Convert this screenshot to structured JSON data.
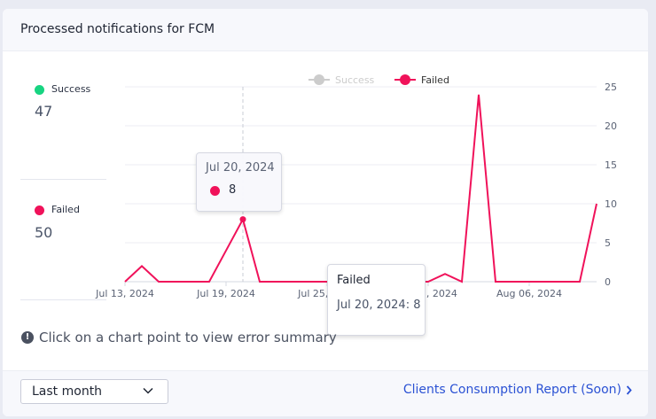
{
  "card": {
    "title": "Processed notifications for FCM"
  },
  "stats": [
    {
      "label": "Success",
      "value": "47",
      "color": "#17d481"
    },
    {
      "label": "Failed",
      "value": "50",
      "color": "#f0125a"
    }
  ],
  "chart_data": {
    "type": "line",
    "x_ticks": [
      "Jul 13, 2024",
      "Jul 19, 2024",
      "Jul 25, 2024",
      "Jul 31, 2024",
      "Aug 06, 2024"
    ],
    "y_ticks": [
      "25",
      "20",
      "15",
      "10",
      "5",
      "0"
    ],
    "ylim": [
      0,
      25
    ],
    "legend_position": "top-center",
    "grid": "horizontal",
    "x": [
      "Jul 13, 2024",
      "Jul 14, 2024",
      "Jul 15, 2024",
      "Jul 16, 2024",
      "Jul 17, 2024",
      "Jul 18, 2024",
      "Jul 19, 2024",
      "Jul 20, 2024",
      "Jul 21, 2024",
      "Jul 22, 2024",
      "Jul 23, 2024",
      "Jul 24, 2024",
      "Jul 25, 2024",
      "Jul 26, 2024",
      "Jul 27, 2024",
      "Jul 28, 2024",
      "Jul 29, 2024",
      "Jul 30, 2024",
      "Jul 31, 2024",
      "Aug 01, 2024",
      "Aug 02, 2024",
      "Aug 03, 2024",
      "Aug 04, 2024",
      "Aug 05, 2024",
      "Aug 06, 2024",
      "Aug 07, 2024",
      "Aug 08, 2024",
      "Aug 09, 2024",
      "Aug 10, 2024"
    ],
    "series": [
      {
        "name": "Success",
        "color": "#c7c7c7",
        "hidden": true,
        "values": []
      },
      {
        "name": "Failed",
        "color": "#f0125a",
        "hidden": false,
        "values": [
          0,
          2,
          0,
          0,
          0,
          0,
          4,
          8,
          0,
          0,
          0,
          0,
          0,
          0,
          0,
          0,
          0,
          0,
          0,
          1,
          0,
          24,
          0,
          0,
          0,
          0,
          0,
          0,
          10
        ]
      }
    ]
  },
  "tooltip_hover": {
    "date": "Jul 20, 2024",
    "value": "8"
  },
  "tooltip_point": {
    "title": "Failed",
    "text": "Jul 20, 2024: 8"
  },
  "hint": {
    "text": "Click on a chart point to view error summary"
  },
  "footer": {
    "range_select": "Last month",
    "report_link": "Clients Consumption Report (Soon)"
  }
}
